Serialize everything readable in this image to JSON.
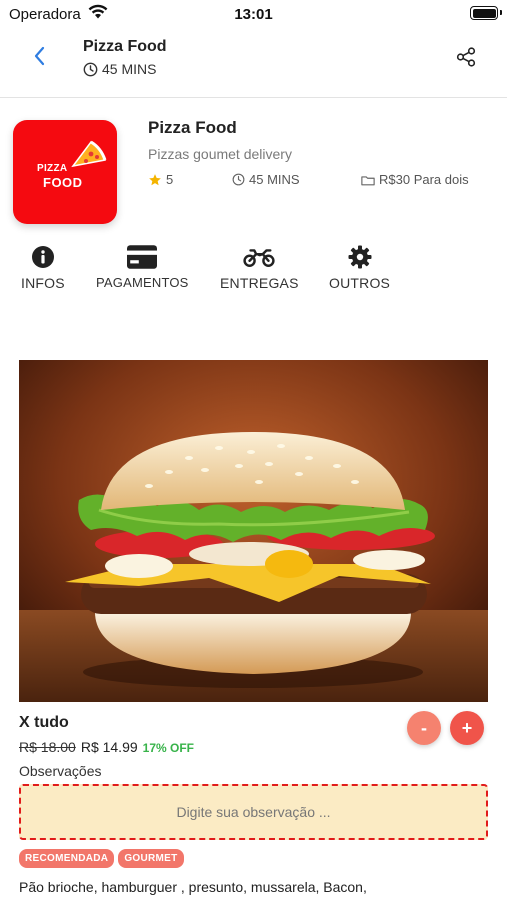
{
  "status_bar": {
    "carrier": "Operadora",
    "time": "13:01",
    "battery_level": 1.0
  },
  "nav": {
    "title": "Pizza Food",
    "subtitle": "45 MINS",
    "back_icon": "chevron-left-icon",
    "share_icon": "share-icon"
  },
  "restaurant": {
    "logo_line1": "PIZZA",
    "logo_line2": "FOOD",
    "name": "Pizza Food",
    "description": "Pizzas goumet delivery",
    "rating": "5",
    "time": "45 MINS",
    "price_range": "R$30 Para dois"
  },
  "tabs": [
    {
      "label": "INFOS",
      "icon": "info-icon"
    },
    {
      "label": "PAGAMENTOS",
      "icon": "credit-card-icon"
    },
    {
      "label": "ENTREGAS",
      "icon": "motorcycle-icon"
    },
    {
      "label": "OUTROS",
      "icon": "gear-icon"
    }
  ],
  "product": {
    "name": "X tudo",
    "old_price": "R$ 18.00",
    "new_price": "R$ 14.99",
    "discount": "17% OFF",
    "minus_label": "-",
    "plus_label": "+",
    "observations_label": "Observações",
    "observations_placeholder": "Digite sua observação ...",
    "tags": [
      "RECOMENDADA",
      "GOURMET"
    ],
    "ingredients": "Pão brioche, hamburguer , presunto, mussarela, Bacon,"
  },
  "colors": {
    "accent": "#f50a10",
    "minus_button": "#f5826f",
    "plus_button": "#f0544a",
    "tag": "#f2766a",
    "discount": "#38b34a",
    "star": "#f4b400",
    "back_arrow": "#2f7de1"
  }
}
